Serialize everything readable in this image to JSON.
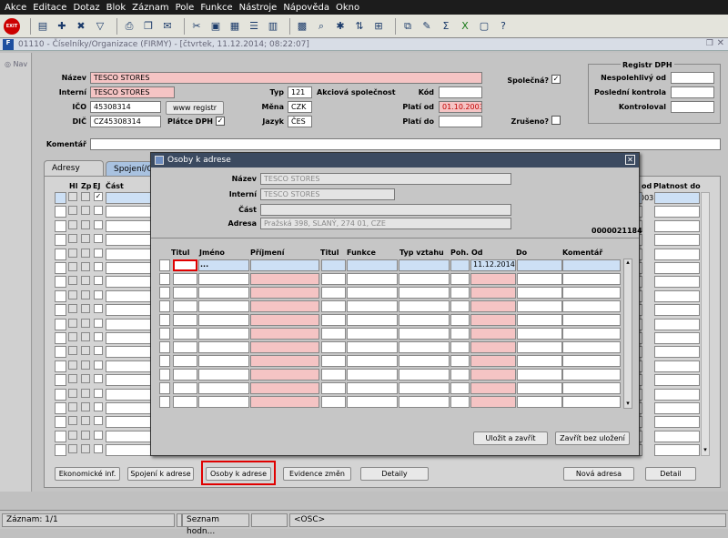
{
  "menu": [
    "Akce",
    "Editace",
    "Dotaz",
    "Blok",
    "Záznam",
    "Pole",
    "Funkce",
    "Nástroje",
    "Nápověda",
    "Okno"
  ],
  "toolbar": {
    "exit_label": "EXIT"
  },
  "window": {
    "title": "01110 - Číselníky/Organizace (FIRMY) - [čtvrtek, 11.12.2014; 08:22:07]"
  },
  "nav": {
    "label": "Nav"
  },
  "form": {
    "nazev_label": "Název",
    "nazev_value": "TESCO STORES",
    "interni_label": "Interní",
    "interni_value": "TESCO STORES",
    "ico_label": "IČO",
    "ico_value": "45308314",
    "dic_label": "DIČ",
    "dic_value": "CZ45308314",
    "www_label": "www registr",
    "platce_label": "Plátce DPH",
    "typ_label": "Typ",
    "typ_value": "121",
    "typ_desc": "Akciová společnost",
    "mena_label": "Měna",
    "mena_value": "CZK",
    "jazyk_label": "Jazyk",
    "jazyk_value": "ČES",
    "kod_label": "Kód",
    "platiod_label": "Platí od",
    "platiod_value": "01.10.2003",
    "platido_label": "Platí do",
    "spolecna_label": "Společná?",
    "zruseno_label": "Zrušeno?",
    "komentar_label": "Komentář"
  },
  "dph": {
    "title": "Registr DPH",
    "nespolehlivy": "Nespolehlivý od",
    "kontrola": "Poslední kontrola",
    "kontrolovai": "Kontroloval"
  },
  "tabs": {
    "adresy": "Adresy",
    "spojeni": "Spojení/C"
  },
  "addr_grid": {
    "hl": "Hl",
    "zp": "Zp",
    "ej": "EJ",
    "cast": "Část",
    "platnost_od_tail": "od",
    "platnost_do": "Platnost do",
    "date_tail": "003"
  },
  "bottom_buttons": {
    "ekonomicke": "Ekonomické inf.",
    "spojeni": "Spojení k adrese",
    "osoby": "Osoby k adrese",
    "evidence": "Evidence změn",
    "detaily": "Detaily",
    "nova": "Nová adresa",
    "detail": "Detail"
  },
  "dialog": {
    "title": "Osoby k adrese",
    "nazev_label": "Název",
    "nazev_value": "TESCO STORES",
    "interni_label": "Interní",
    "interni_value": "TESCO STORES",
    "cast_label": "Část",
    "adresa_label": "Adresa",
    "adresa_value": "Pražská 398, SLANÝ, 274 01, CZE",
    "id_value": "0000021184",
    "columns": [
      "Titul",
      "Jméno",
      "Příjmení",
      "Titul",
      "Funkce",
      "Typ vztahu",
      "Poh.",
      "Od",
      "Do",
      "Komentář"
    ],
    "first_row": {
      "jmeno": "...",
      "od": "11.12.2014"
    },
    "save_label": "Uložit a zavřít",
    "close_label": "Zavřít bez uložení"
  },
  "status": {
    "zaznam": "Záznam: 1/1",
    "seznam": "Seznam hodn...",
    "osc": "<OSC>"
  },
  "colors": {
    "required_pink": "#f5c4c4",
    "selected_row_blue": "#cde0f5",
    "highlight_red": "#e00000",
    "dialog_title": "#3b4a60"
  }
}
